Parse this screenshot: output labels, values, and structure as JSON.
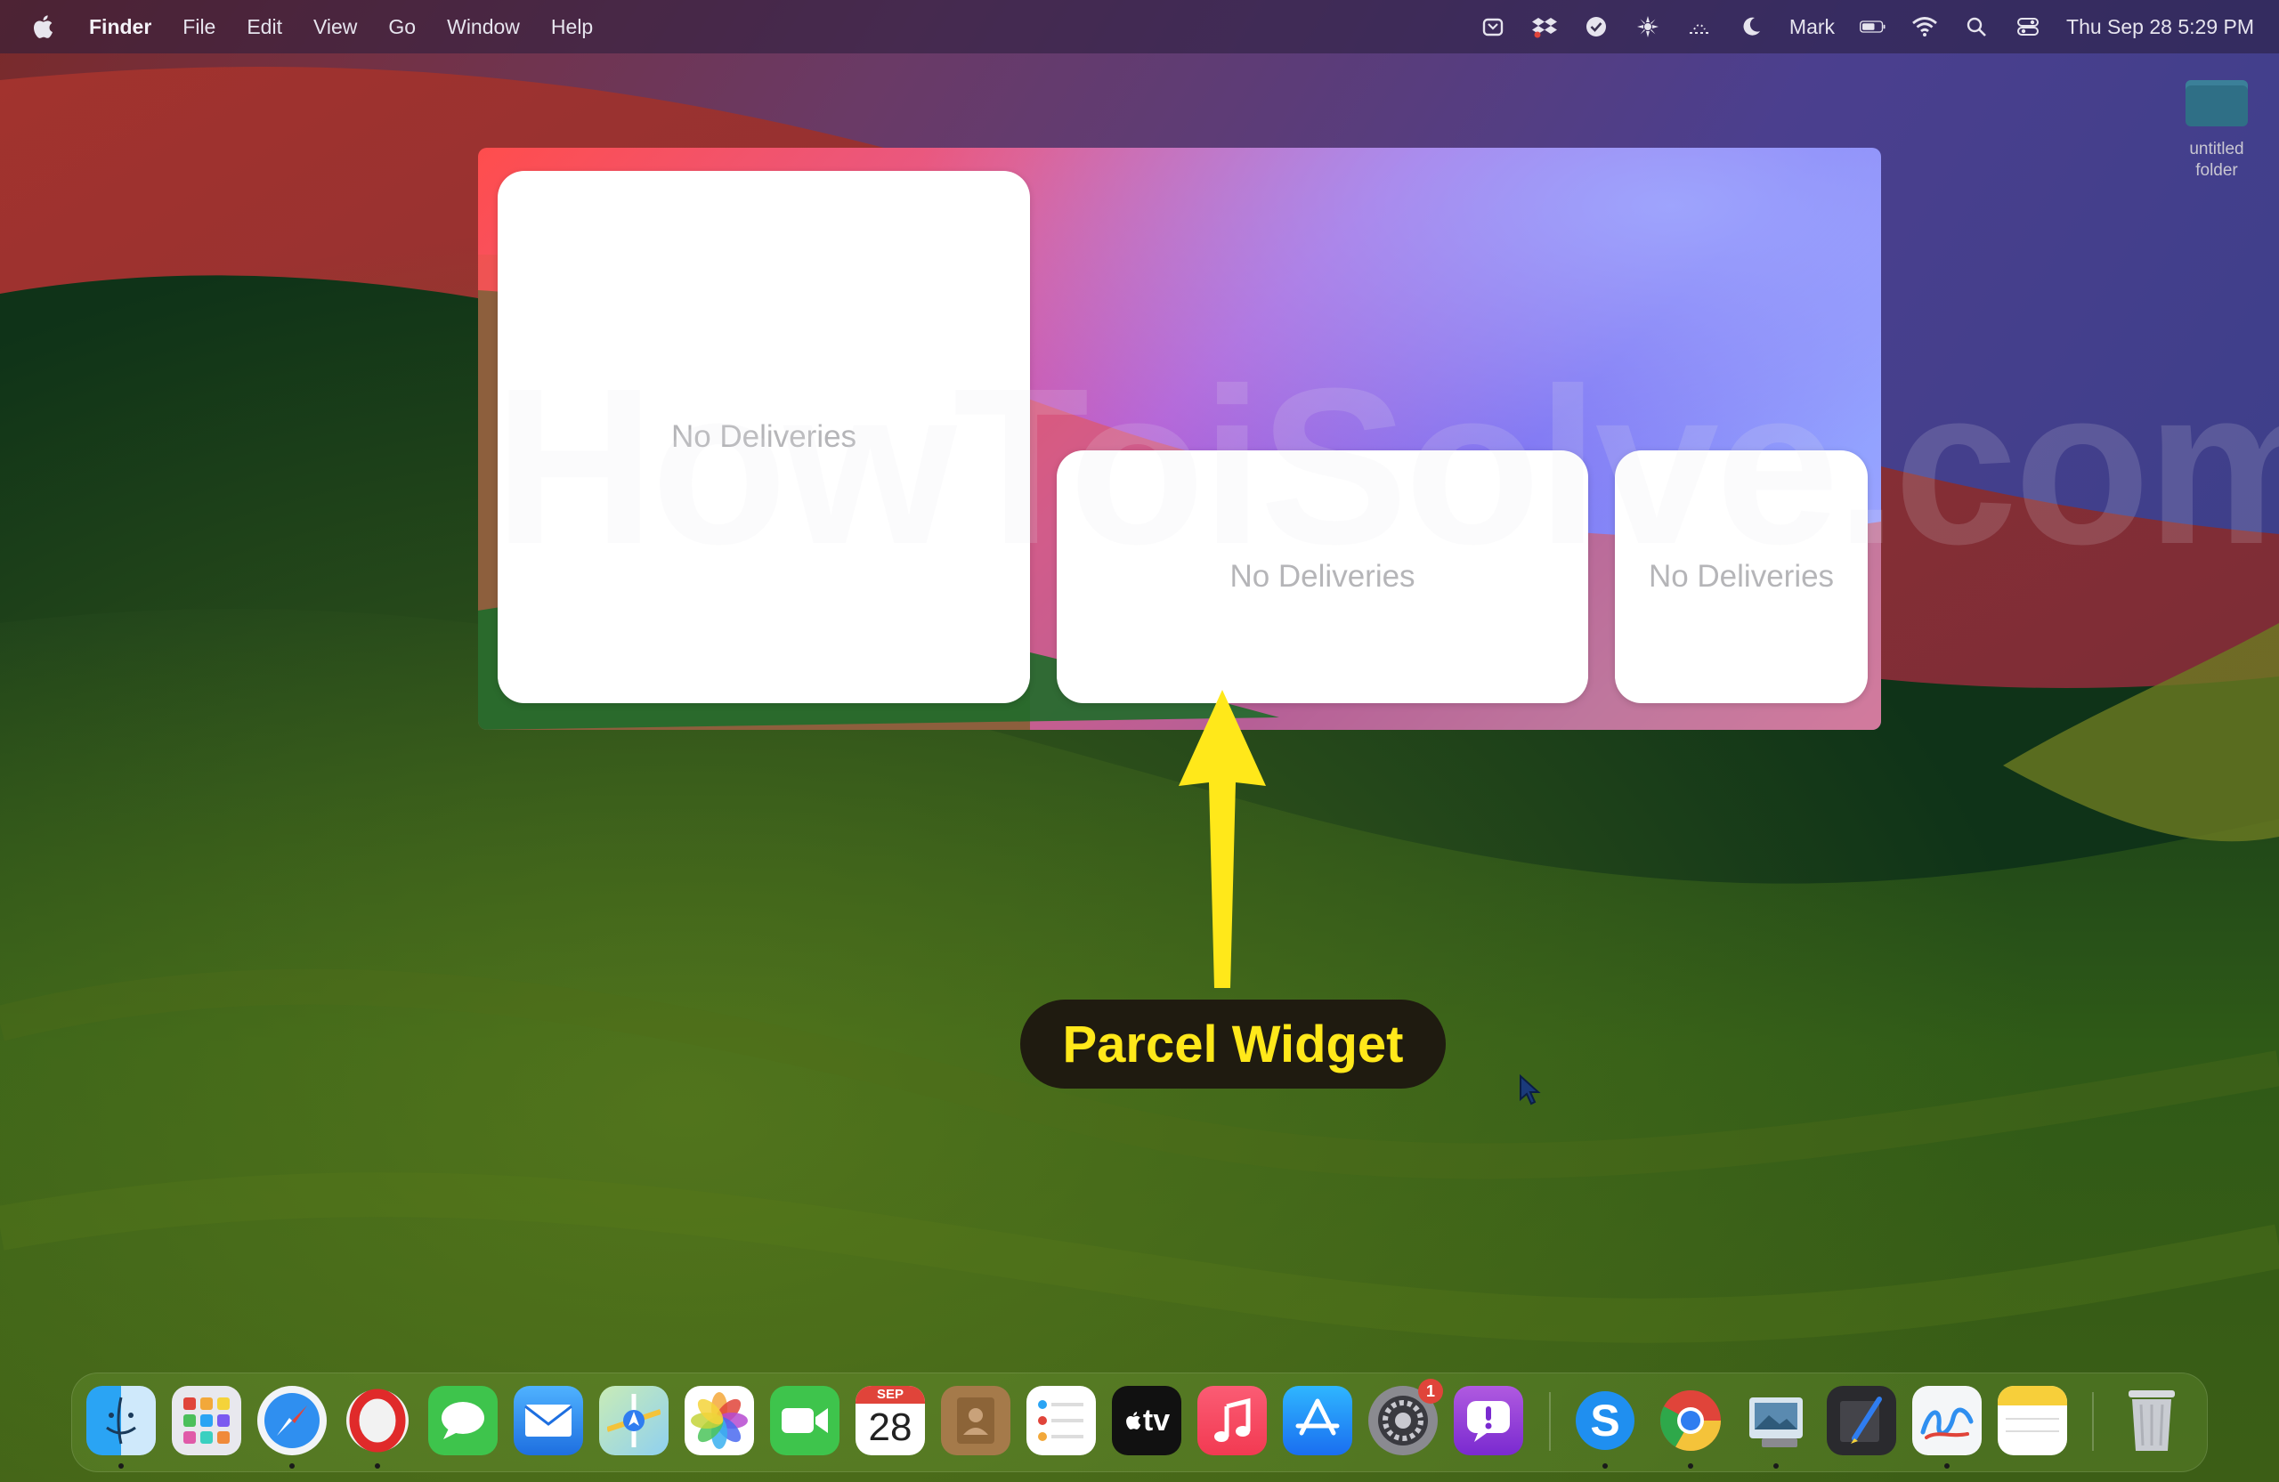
{
  "menubar": {
    "app_name": "Finder",
    "menus": [
      "File",
      "Edit",
      "View",
      "Go",
      "Window",
      "Help"
    ],
    "status_icons": [
      "wallet-icon",
      "dropbox-icon",
      "checklist-icon",
      "cog-flower-icon",
      "weather-icon",
      "moon-icon"
    ],
    "user_name": "Mark",
    "datetime": "Thu Sep 28  5:29 PM"
  },
  "desktop": {
    "folder_label_line1": "untitled",
    "folder_label_line2": "folder"
  },
  "widgets": {
    "large_text": "No Deliveries",
    "medium_text": "No Deliveries",
    "small_text": "No Deliveries"
  },
  "watermark": "HowToiSolve.com",
  "annotation": {
    "label": "Parcel Widget",
    "color": "#ffe81a"
  },
  "dock": {
    "calendar_month": "SEP",
    "calendar_day": "28",
    "settings_badge": "1",
    "apple_tv_label": "tv",
    "skype_letter": "S",
    "apps": [
      "Finder",
      "Launchpad",
      "Safari",
      "Opera",
      "Messages",
      "Mail",
      "Maps",
      "Photos",
      "FaceTime",
      "Calendar",
      "Contacts",
      "Reminders",
      "Apple TV",
      "Music",
      "App Store",
      "System Settings",
      "Feedback Assistant",
      "Skype",
      "Chrome",
      "Preview",
      "Script Editor",
      "Freeform",
      "Notes",
      "Trash"
    ]
  }
}
